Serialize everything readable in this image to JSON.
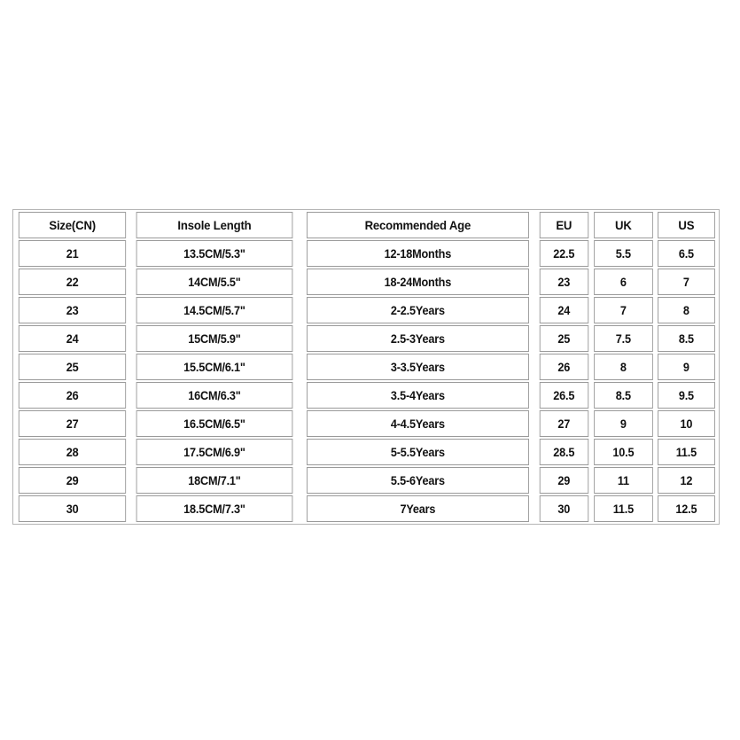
{
  "table": {
    "name": "shoe-size-chart",
    "columns": [
      {
        "key": "size_cn",
        "label": "Size(CN)"
      },
      {
        "key": "insole_length",
        "label": "Insole Length"
      },
      {
        "key": "recommended_age",
        "label": "Recommended Age"
      },
      {
        "key": "eu",
        "label": "EU"
      },
      {
        "key": "uk",
        "label": "UK"
      },
      {
        "key": "us",
        "label": "US"
      }
    ],
    "rows": [
      {
        "size_cn": "21",
        "insole_length": "13.5CM/5.3\"",
        "recommended_age": "12-18Months",
        "eu": "22.5",
        "uk": "5.5",
        "us": "6.5"
      },
      {
        "size_cn": "22",
        "insole_length": "14CM/5.5\"",
        "recommended_age": "18-24Months",
        "eu": "23",
        "uk": "6",
        "us": "7"
      },
      {
        "size_cn": "23",
        "insole_length": "14.5CM/5.7\"",
        "recommended_age": "2-2.5Years",
        "eu": "24",
        "uk": "7",
        "us": "8"
      },
      {
        "size_cn": "24",
        "insole_length": "15CM/5.9\"",
        "recommended_age": "2.5-3Years",
        "eu": "25",
        "uk": "7.5",
        "us": "8.5"
      },
      {
        "size_cn": "25",
        "insole_length": "15.5CM/6.1\"",
        "recommended_age": "3-3.5Years",
        "eu": "26",
        "uk": "8",
        "us": "9"
      },
      {
        "size_cn": "26",
        "insole_length": "16CM/6.3\"",
        "recommended_age": "3.5-4Years",
        "eu": "26.5",
        "uk": "8.5",
        "us": "9.5"
      },
      {
        "size_cn": "27",
        "insole_length": "16.5CM/6.5\"",
        "recommended_age": "4-4.5Years",
        "eu": "27",
        "uk": "9",
        "us": "10"
      },
      {
        "size_cn": "28",
        "insole_length": "17.5CM/6.9\"",
        "recommended_age": "5-5.5Years",
        "eu": "28.5",
        "uk": "10.5",
        "us": "11.5"
      },
      {
        "size_cn": "29",
        "insole_length": "18CM/7.1\"",
        "recommended_age": "5.5-6Years",
        "eu": "29",
        "uk": "11",
        "us": "12"
      },
      {
        "size_cn": "30",
        "insole_length": "18.5CM/7.3\"",
        "recommended_age": "7Years",
        "eu": "30",
        "uk": "11.5",
        "us": "12.5"
      }
    ]
  },
  "colors": {
    "page_background": "#ffffff",
    "cell_background": "#ffffff",
    "cell_border": "#9a9a9a",
    "table_border": "#b4b4b4",
    "text": "#111111"
  }
}
